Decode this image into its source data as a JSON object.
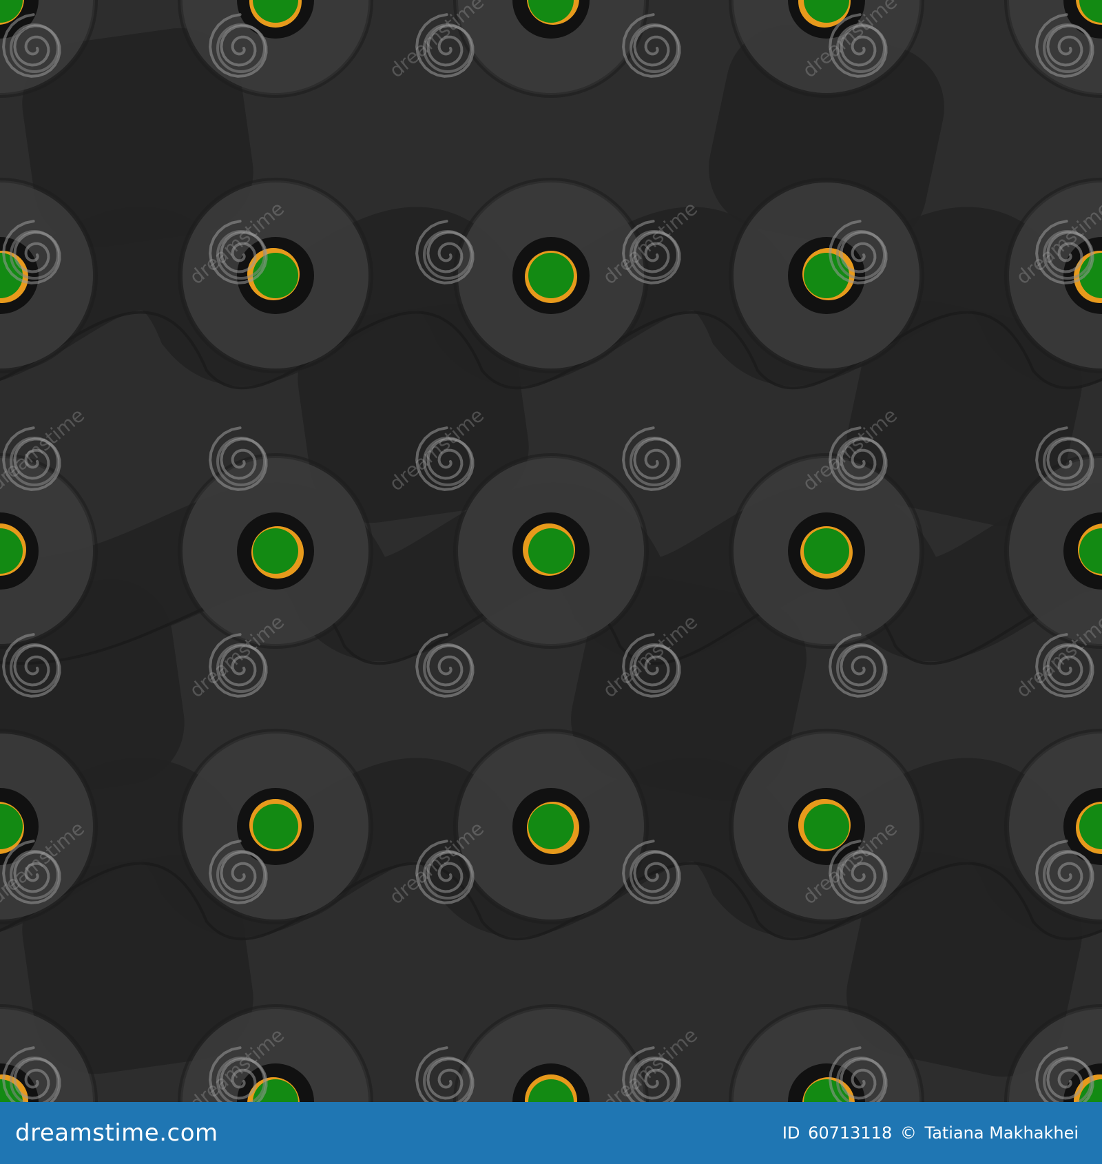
{
  "watermark": {
    "word": "dreamstime",
    "icon": "spiral-logo-icon"
  },
  "footer": {
    "brand": "dreamstime.com",
    "id_label": "ID",
    "id_value": "60713118",
    "copyright_symbol": "©",
    "author": "Tatiana Makhakhei"
  },
  "colors": {
    "background": "#2b2b2b",
    "wave_dark": "#222222",
    "ring": "#3a3a3a",
    "hole": "#111111",
    "dot_green": "#138a13",
    "dot_orange": "#e79a1c",
    "footer_blue": "#1f76b3"
  }
}
